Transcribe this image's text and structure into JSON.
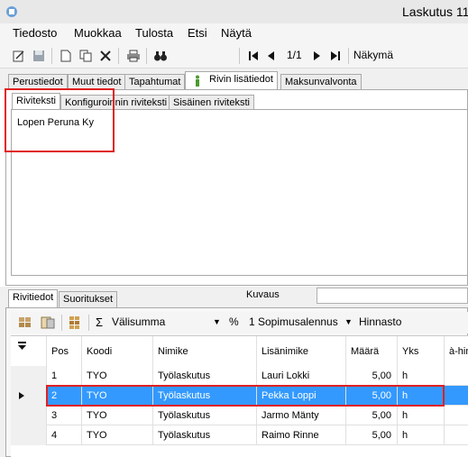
{
  "window": {
    "title": "Laskutus 11"
  },
  "menu": [
    "Tiedosto",
    "Muokkaa",
    "Tulosta",
    "Etsi",
    "Näytä"
  ],
  "toolbar": {
    "page_indicator": "1/1",
    "view_label": "Näkymä"
  },
  "outer_tabs": [
    "Perustiedot",
    "Muut tiedot",
    "Tapahtumat",
    "Rivin lisätiedot",
    "Maksunvalvonta"
  ],
  "inner_tabs": [
    "Riviteksti",
    "Konfiguroinnin riviteksti",
    "Sisäinen riviteksti"
  ],
  "riviteksti": {
    "content": "Lopen Peruna Ky"
  },
  "lower_tabs": [
    "Rivitiedot",
    "Suoritukset"
  ],
  "kuvaus": {
    "label": "Kuvaus",
    "value": ""
  },
  "lower_toolbar": {
    "subtotal_label": "Välisumma",
    "percent_symbol": "%",
    "discount_label": "1 Sopimusalennus",
    "price_list_label": "Hinnasto"
  },
  "grid": {
    "headers": [
      "Pos",
      "Koodi",
      "Nimike",
      "Lisänimike",
      "Määrä",
      "Yks",
      "à-hin"
    ],
    "rows": [
      {
        "pos": "1",
        "koodi": "TYO",
        "nimike": "Työlaskutus",
        "lisanimike": "Lauri Lokki",
        "maara": "5,00",
        "yks": "h"
      },
      {
        "pos": "2",
        "koodi": "TYO",
        "nimike": "Työlaskutus",
        "lisanimike": "Pekka Loppi",
        "maara": "5,00",
        "yks": "h"
      },
      {
        "pos": "3",
        "koodi": "TYO",
        "nimike": "Työlaskutus",
        "lisanimike": "Jarmo Mänty",
        "maara": "5,00",
        "yks": "h"
      },
      {
        "pos": "4",
        "koodi": "TYO",
        "nimike": "Työlaskutus",
        "lisanimike": "Raimo Rinne",
        "maara": "5,00",
        "yks": "h"
      }
    ]
  },
  "colors": {
    "selection": "#3399ff",
    "highlight_box": "#e02020"
  }
}
